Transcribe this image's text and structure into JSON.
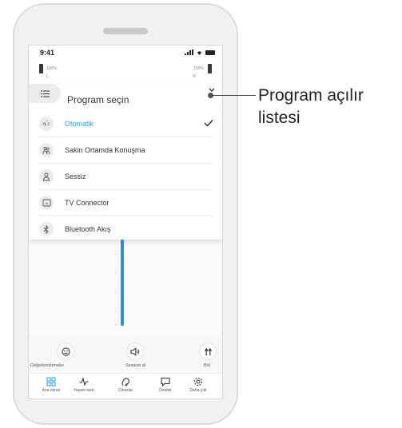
{
  "status_bar": {
    "time": "9:41"
  },
  "hearing_aids": {
    "left": {
      "battery": "100%",
      "side": "L"
    },
    "right": {
      "battery": "100%",
      "side": "R"
    }
  },
  "dropdown": {
    "title": "Program seçin",
    "programs": [
      {
        "label": "Otomatik",
        "selected": true,
        "icon": "auto-program-icon"
      },
      {
        "label": "Sakin Ortamda Konuşma",
        "selected": false,
        "icon": "conversation-icon"
      },
      {
        "label": "Sessiz",
        "selected": false,
        "icon": "quiet-icon"
      },
      {
        "label": "TV Connector",
        "selected": false,
        "icon": "tv-connector-icon"
      },
      {
        "label": "Bluetooth Akış",
        "selected": false,
        "icon": "bluetooth-icon"
      }
    ]
  },
  "actions": {
    "ratings": "Değerlendirmeler",
    "mute": "Sessize al",
    "split": "Böl"
  },
  "tabs": [
    {
      "label": "Ana ekran",
      "icon": "home-grid-icon"
    },
    {
      "label": "Yaşam tarzı",
      "icon": "activity-icon"
    },
    {
      "label": "Cihazlar",
      "icon": "hearing-aid-icon"
    },
    {
      "label": "Destek",
      "icon": "chat-icon"
    },
    {
      "label": "Daha çok",
      "icon": "gear-icon"
    }
  ],
  "callout": {
    "line1": "Program açılır",
    "line2": "listesi"
  },
  "colors": {
    "accent": "#2aa3d8",
    "slider": "#2f8fd2"
  }
}
